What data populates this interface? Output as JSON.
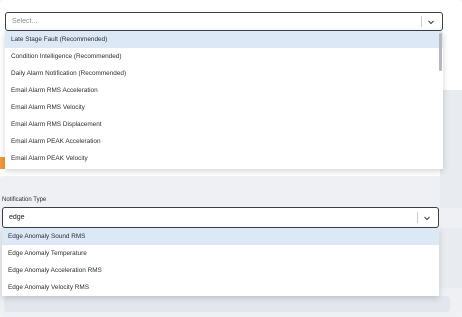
{
  "colors": {
    "accent_highlight": "#dde8f6",
    "border": "#3b4046",
    "orange": "#f29a3a"
  },
  "select1": {
    "placeholder": "Select...",
    "value": "",
    "options": [
      "Late Stage Fault (Recommended)",
      "Condition Intelligence (Recommended)",
      "Daily Alarm Notification (Recommended)",
      "Email Alarm RMS Acceleration",
      "Email Alarm RMS Velocity",
      "Email Alarm RMS Displacement",
      "Email Alarm PEAK Acceleration",
      "Email Alarm PEAK Velocity"
    ],
    "highlighted_index": 0
  },
  "notification": {
    "label": "Notification Type",
    "value": "edge",
    "options": [
      "Edge Anomaly Sound RMS",
      "Edge Anomaly Temperature",
      "Edge Anomaly Acceleration RMS",
      "Edge Anomaly Velocity RMS"
    ],
    "highlighted_index": 0
  },
  "icons": {
    "chevron": "chevron-down-icon"
  }
}
